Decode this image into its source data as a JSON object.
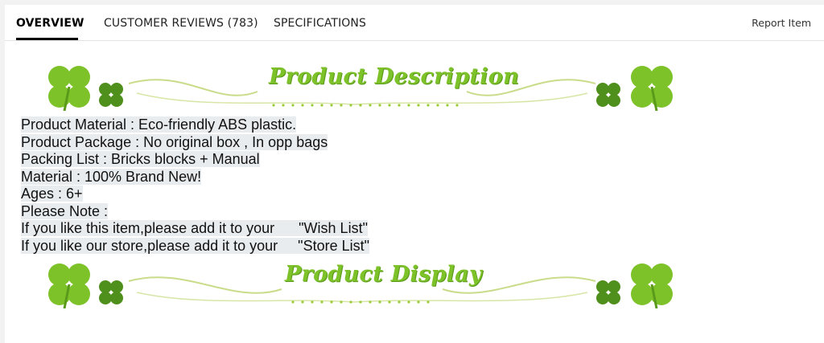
{
  "tabs": [
    {
      "label": "OVERVIEW",
      "active": true
    },
    {
      "label": "CUSTOMER REVIEWS (783)",
      "active": false
    },
    {
      "label": "SPECIFICATIONS",
      "active": false
    }
  ],
  "report_link": "Report Item",
  "banners": {
    "description_title": "Product Description",
    "display_title": "Product Display"
  },
  "description_lines": [
    "Product Material : Eco-friendly ABS plastic.",
    "Product Package : No original box , In opp bags",
    "Packing List : Bricks blocks + Manual",
    "Material : 100% Brand New!",
    "Ages : 6+",
    "Please Note :",
    "If you like this item,please add it to your      \"Wish List\"",
    "If you like our store,please add it to your     \"Store List\""
  ],
  "colors": {
    "clover_light": "#7ec22a",
    "clover_dark": "#4f8f1c",
    "swirl": "#c8dc8a",
    "text_highlight": "#e8ecef"
  },
  "icons": [
    "clover-icon",
    "four-leaf-clover-icon"
  ]
}
